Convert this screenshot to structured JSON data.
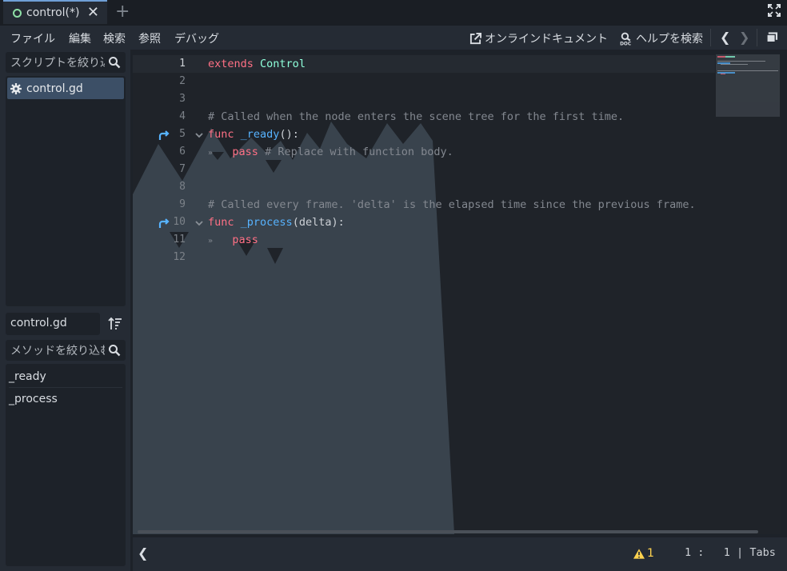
{
  "tab": {
    "title": "control(*)"
  },
  "menu": {
    "file": "ファイル",
    "edit": "編集",
    "search": "検索",
    "goto": "参照",
    "debug": "デバッグ"
  },
  "right_menu": {
    "online_docs": "オンラインドキュメント",
    "search_help": "ヘルプを検索"
  },
  "scripts": {
    "filter_placeholder": "スクリプトを絞り込む",
    "items": [
      {
        "label": "control.gd"
      }
    ]
  },
  "current_script": {
    "name": "control.gd"
  },
  "methods": {
    "filter_placeholder": "メソッドを絞り込む",
    "items": [
      {
        "label": "_ready"
      },
      {
        "label": "_process"
      }
    ]
  },
  "editor": {
    "line_numbers": [
      "1",
      "2",
      "3",
      "4",
      "5",
      "6",
      "7",
      "8",
      "9",
      "10",
      "11",
      "12"
    ],
    "code": {
      "l1_kw": "extends",
      "l1_cls": "Control",
      "l4": "# Called when the node enters the scene tree for the first time.",
      "l5_kw": "func",
      "l5_fn": "_ready",
      "l5_rest": "():",
      "l6_kw": "pass",
      "l6_cm": "# Replace with function body.",
      "l9": "# Called every frame. 'delta' is the elapsed time since the previous frame.",
      "l10_kw": "func",
      "l10_fn": "_process",
      "l10_rest": "(delta):",
      "l11_kw": "pass"
    }
  },
  "status": {
    "warnings": "1",
    "line": "1",
    "col": "1",
    "indent": "Tabs"
  },
  "colors": {
    "keyword": "#ff7085",
    "class": "#8effda",
    "function": "#57b3ff",
    "comment": "#838890",
    "accent": "#6f9fd6"
  }
}
